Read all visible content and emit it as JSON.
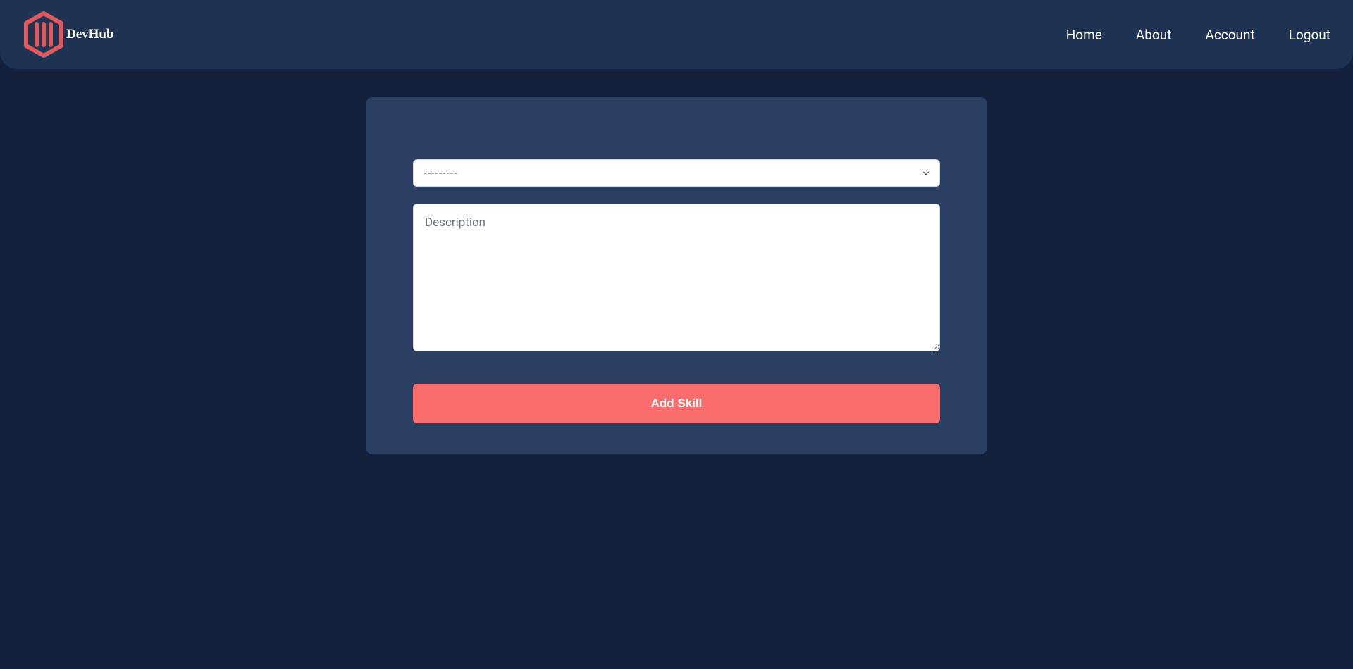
{
  "brand": {
    "name": "DevHub"
  },
  "nav": {
    "items": [
      {
        "label": "Home"
      },
      {
        "label": "About"
      },
      {
        "label": "Account"
      },
      {
        "label": "Logout"
      }
    ]
  },
  "form": {
    "skill_select": {
      "selected": "---------"
    },
    "description": {
      "placeholder": "Description",
      "value": ""
    },
    "submit_label": "Add Skill"
  },
  "colors": {
    "background": "#14213d",
    "navbar": "#1f3355",
    "card": "#2a3f62",
    "accent": "#fa6d6d",
    "logo_accent": "#e05a5a"
  }
}
